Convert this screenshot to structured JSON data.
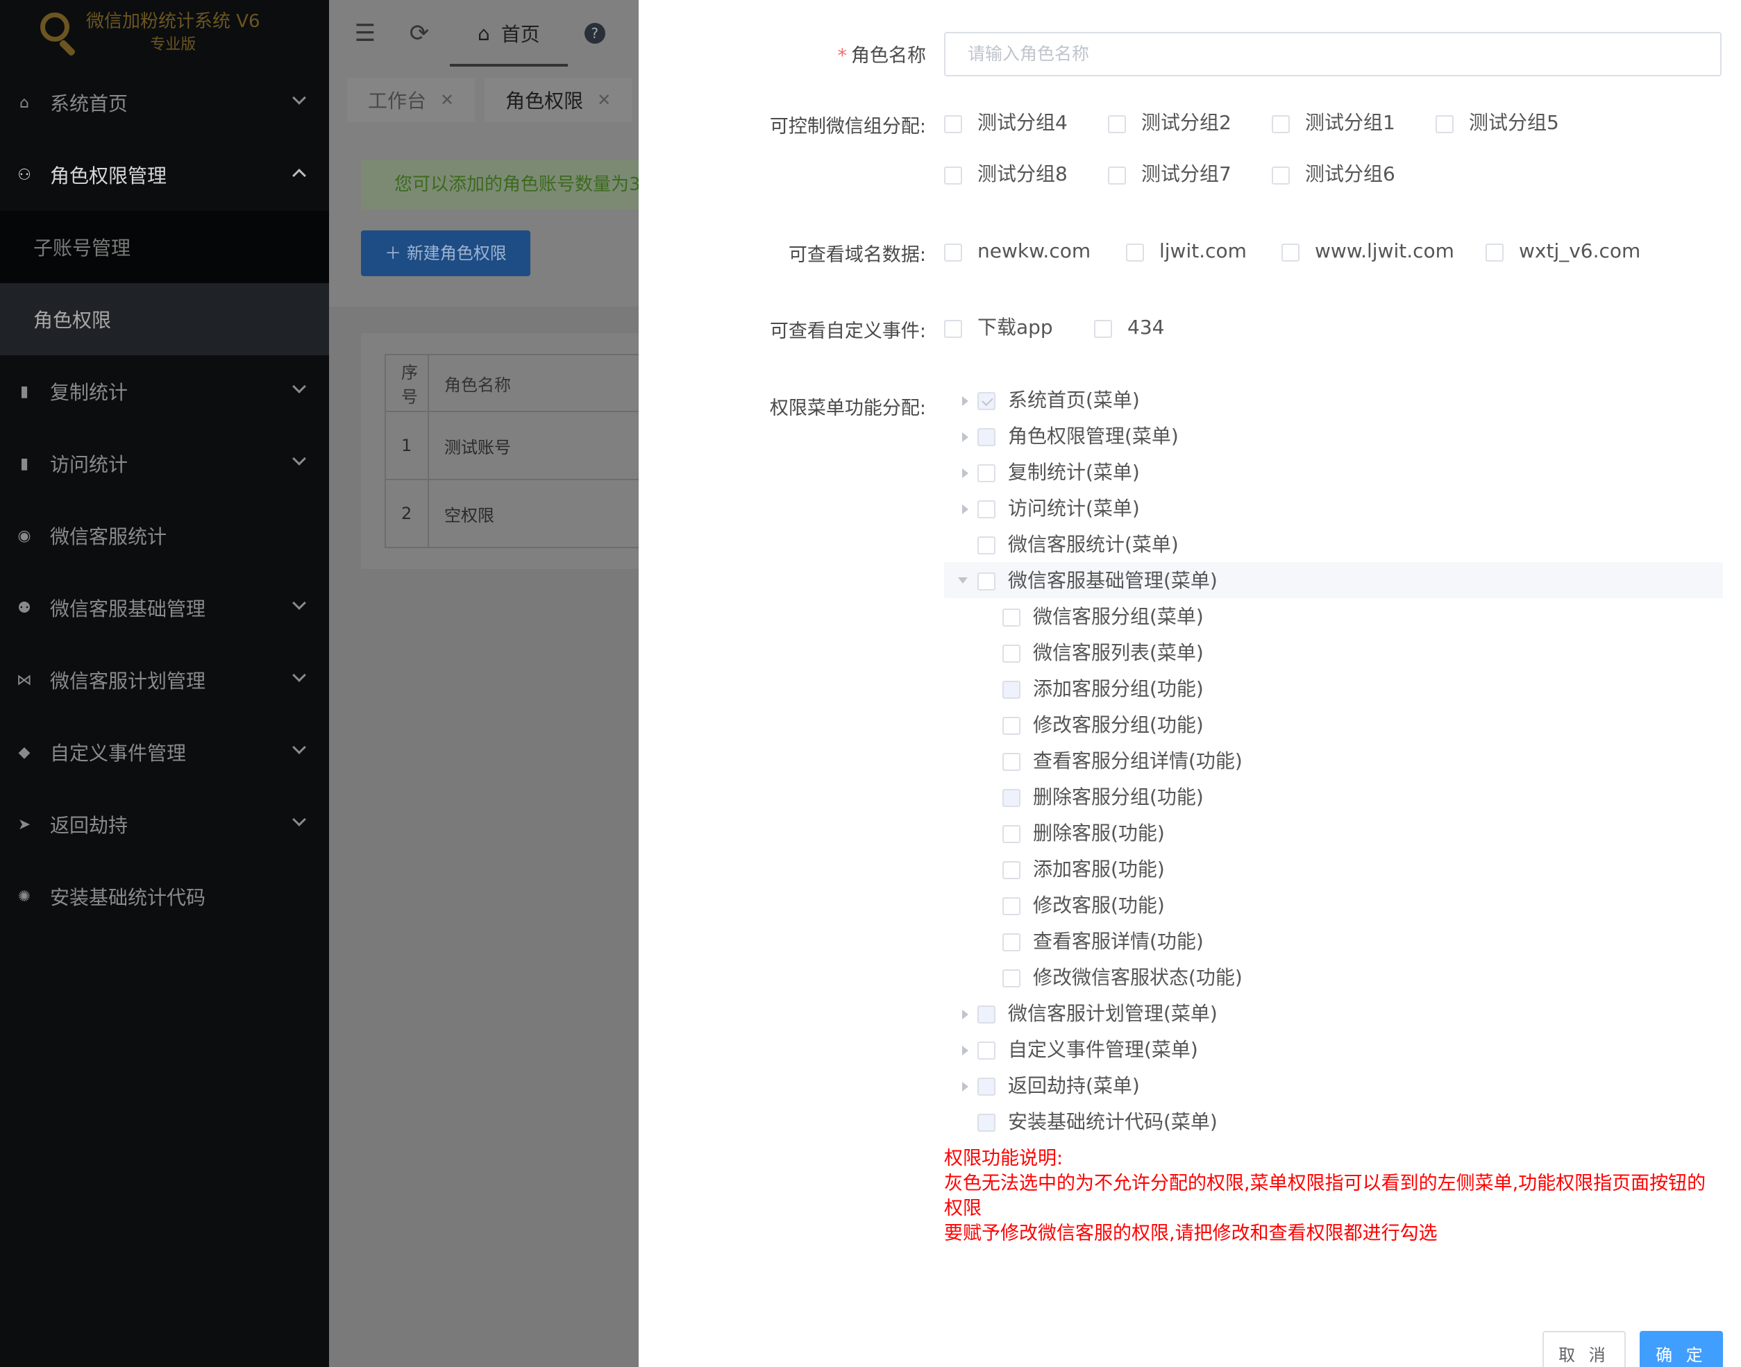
{
  "sidebar": {
    "logo_title": "微信加粉统计系统 V6",
    "logo_sub": "专业版",
    "items": [
      {
        "label": "系统首页",
        "icon": "home-icon"
      },
      {
        "label": "角色权限管理",
        "icon": "user-add-icon"
      },
      {
        "label": "子账号管理"
      },
      {
        "label": "角色权限"
      },
      {
        "label": "复制统计",
        "icon": "bar-chart-icon"
      },
      {
        "label": "访问统计",
        "icon": "bar-chart-icon"
      },
      {
        "label": "微信客服统计",
        "icon": "headset-icon"
      },
      {
        "label": "微信客服基础管理",
        "icon": "users-icon"
      },
      {
        "label": "微信客服计划管理",
        "icon": "network-icon"
      },
      {
        "label": "自定义事件管理",
        "icon": "box-icon"
      },
      {
        "label": "返回劫持",
        "icon": "send-icon"
      },
      {
        "label": "安装基础统计代码",
        "icon": "gear-icon"
      }
    ]
  },
  "header": {
    "home_tab": "首页",
    "tags": [
      {
        "label": "工作台"
      },
      {
        "label": "角色权限"
      }
    ]
  },
  "main": {
    "notice": "您可以添加的角色账号数量为3",
    "new_button": "新建角色权限",
    "table": {
      "headers": [
        "序号",
        "角色名称"
      ],
      "rows": [
        [
          "1",
          "测试账号"
        ],
        [
          "2",
          "空权限"
        ]
      ]
    }
  },
  "drawer": {
    "role_name_label": "角色名称",
    "role_name_placeholder": "请输入角色名称",
    "group_label": "可控制微信组分配:",
    "groups": [
      "测试分组4",
      "测试分组2",
      "测试分组1",
      "测试分组5",
      "测试分组8",
      "测试分组7",
      "测试分组6"
    ],
    "domain_label": "可查看域名数据:",
    "domains": [
      "newkw.com",
      "ljwit.com",
      "www.ljwit.com",
      "wxtj_v6.com"
    ],
    "event_label": "可查看自定义事件:",
    "events": [
      "下载app",
      "434"
    ],
    "menu_label": "权限菜单功能分配:",
    "tree": [
      "系统首页(菜单)",
      "角色权限管理(菜单)",
      "复制统计(菜单)",
      "访问统计(菜单)",
      "微信客服统计(菜单)",
      "微信客服基础管理(菜单)",
      "微信客服分组(菜单)",
      "微信客服列表(菜单)",
      "添加客服分组(功能)",
      "修改客服分组(功能)",
      "查看客服分组详情(功能)",
      "删除客服分组(功能)",
      "删除客服(功能)",
      "添加客服(功能)",
      "修改客服(功能)",
      "查看客服详情(功能)",
      "修改微信客服状态(功能)",
      "微信客服计划管理(菜单)",
      "自定义事件管理(菜单)",
      "返回劫持(菜单)",
      "安装基础统计代码(菜单)"
    ],
    "note": {
      "title": "权限功能说明:",
      "line1": "灰色无法选中的为不允许分配的权限,菜单权限指可以看到的左侧菜单,功能权限指页面按钮的权限",
      "line2": "要赋予修改微信客服的权限,请把修改和查看权限都进行勾选"
    },
    "cancel": "取 消",
    "confirm": "确 定"
  }
}
